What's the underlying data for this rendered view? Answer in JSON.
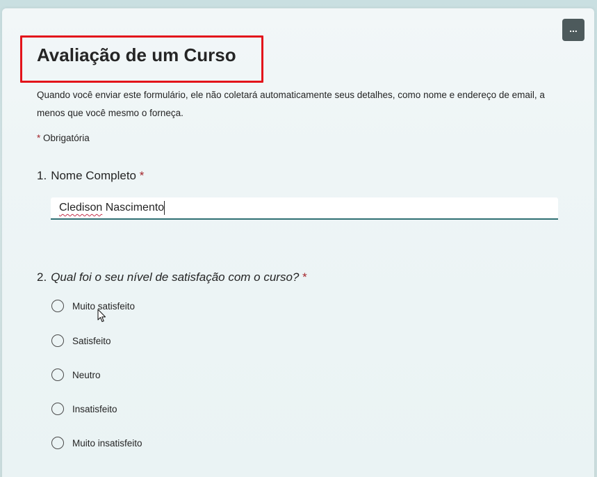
{
  "form": {
    "title": "Avaliação de um Curso",
    "description": "Quando você enviar este formulário, ele não coletará automaticamente seus detalhes, como nome e endereço de email, a menos que você mesmo o forneça.",
    "required_marker": "*",
    "required_note": "Obrigatória",
    "more_options_label": "..."
  },
  "questions": [
    {
      "number": "1.",
      "text": "Nome Completo",
      "required": "*",
      "answer_first": "Cledison",
      "answer_rest": " Nascimento"
    },
    {
      "number": "2.",
      "text": "Qual foi o seu nível de satisfação com o curso?",
      "required": "*",
      "options": [
        "Muito satisfeito",
        "Satisfeito",
        "Neutro",
        "Insatisfeito",
        "Muito insatisfeito"
      ]
    }
  ],
  "colors": {
    "highlight_box": "#e3141b",
    "required_asterisk": "#a4262c",
    "input_underline": "#2f6f73"
  },
  "icons": {
    "more": "more-options-icon",
    "radio": "radio-button-icon",
    "cursor": "mouse-pointer-icon"
  }
}
